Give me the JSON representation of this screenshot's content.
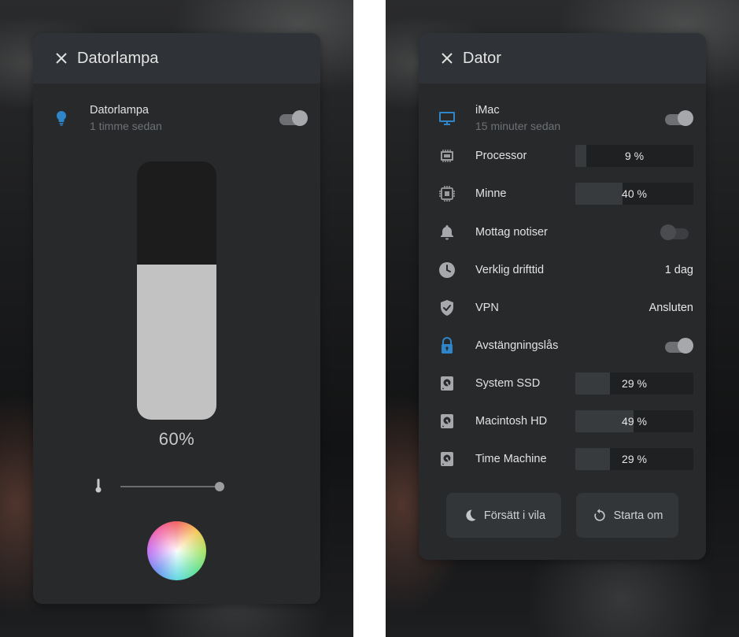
{
  "colors": {
    "accent_blue": "#2e85c9",
    "card_bg": "#27292b",
    "header_bg": "#2f3236"
  },
  "lamp_panel": {
    "title": "Datorlampa",
    "entity": {
      "icon": "lightbulb-icon",
      "name": "Datorlampa",
      "last_changed": "1 timme sedan",
      "state_on": true
    },
    "brightness": {
      "percent": 60,
      "label": "60%"
    },
    "color_temp_icon": "thermometer-icon",
    "color_temp_position": 1.0,
    "color_wheel_icon": "color-wheel"
  },
  "computer_panel": {
    "title": "Dator",
    "header_entity": {
      "icon": "monitor-icon",
      "name": "iMac",
      "last_changed": "15 minuter sedan",
      "state_on": true
    },
    "rows": [
      {
        "icon": "cpu-icon",
        "label": "Processor",
        "type": "bar",
        "value": 9,
        "value_text": "9 %"
      },
      {
        "icon": "memory-chip-icon",
        "label": "Minne",
        "type": "bar",
        "value": 40,
        "value_text": "40 %"
      },
      {
        "icon": "bell-icon",
        "label": "Mottag notiser",
        "type": "toggle",
        "state_on": false
      },
      {
        "icon": "clock-icon",
        "label": "Verklig drifttid",
        "type": "text",
        "value_text": "1 dag"
      },
      {
        "icon": "shield-check-icon",
        "label": "VPN",
        "type": "text",
        "value_text": "Ansluten"
      },
      {
        "icon": "lock-icon",
        "label": "Avstängningslås",
        "type": "toggle",
        "state_on": true
      },
      {
        "icon": "harddisk-icon",
        "label": "System SSD",
        "type": "bar",
        "value": 29,
        "value_text": "29 %"
      },
      {
        "icon": "harddisk-icon",
        "label": "Macintosh HD",
        "type": "bar",
        "value": 49,
        "value_text": "49 %"
      },
      {
        "icon": "harddisk-icon",
        "label": "Time Machine",
        "type": "bar",
        "value": 29,
        "value_text": "29 %"
      }
    ],
    "buttons": {
      "sleep": {
        "icon": "moon-icon",
        "label": "Försätt i vila"
      },
      "restart": {
        "icon": "restart-icon",
        "label": "Starta om"
      }
    }
  }
}
